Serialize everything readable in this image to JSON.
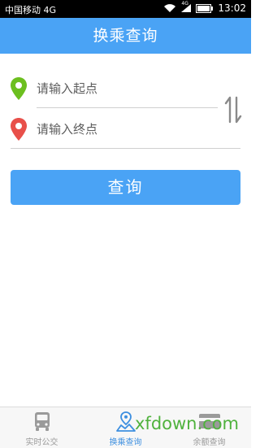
{
  "status_bar": {
    "carrier": "中国移动 4G",
    "network_badge": "4G",
    "time": "13:02",
    "icons": [
      "wifi-icon",
      "signal-icon",
      "battery-icon"
    ]
  },
  "header": {
    "title": "换乘查询"
  },
  "form": {
    "start_placeholder": "请输入起点",
    "end_placeholder": "请输入终点",
    "swap_icon": "swap-vertical-icon",
    "start_icon": "green-location-pin-icon",
    "end_icon": "red-location-pin-icon",
    "query_button": "查询"
  },
  "bottom_nav": {
    "items": [
      {
        "label": "实时公交",
        "icon": "bus-icon",
        "active": false
      },
      {
        "label": "换乘查询",
        "icon": "route-map-icon",
        "active": true
      },
      {
        "label": "余额查询",
        "icon": "card-icon",
        "active": false
      }
    ]
  },
  "watermark": {
    "text": "xfdown.com"
  },
  "colors": {
    "primary": "#4aa3f5",
    "start_pin": "#6cbf1f",
    "end_pin": "#e8504a",
    "nav_active": "#3d8fe0",
    "watermark": "#4fb23d"
  }
}
